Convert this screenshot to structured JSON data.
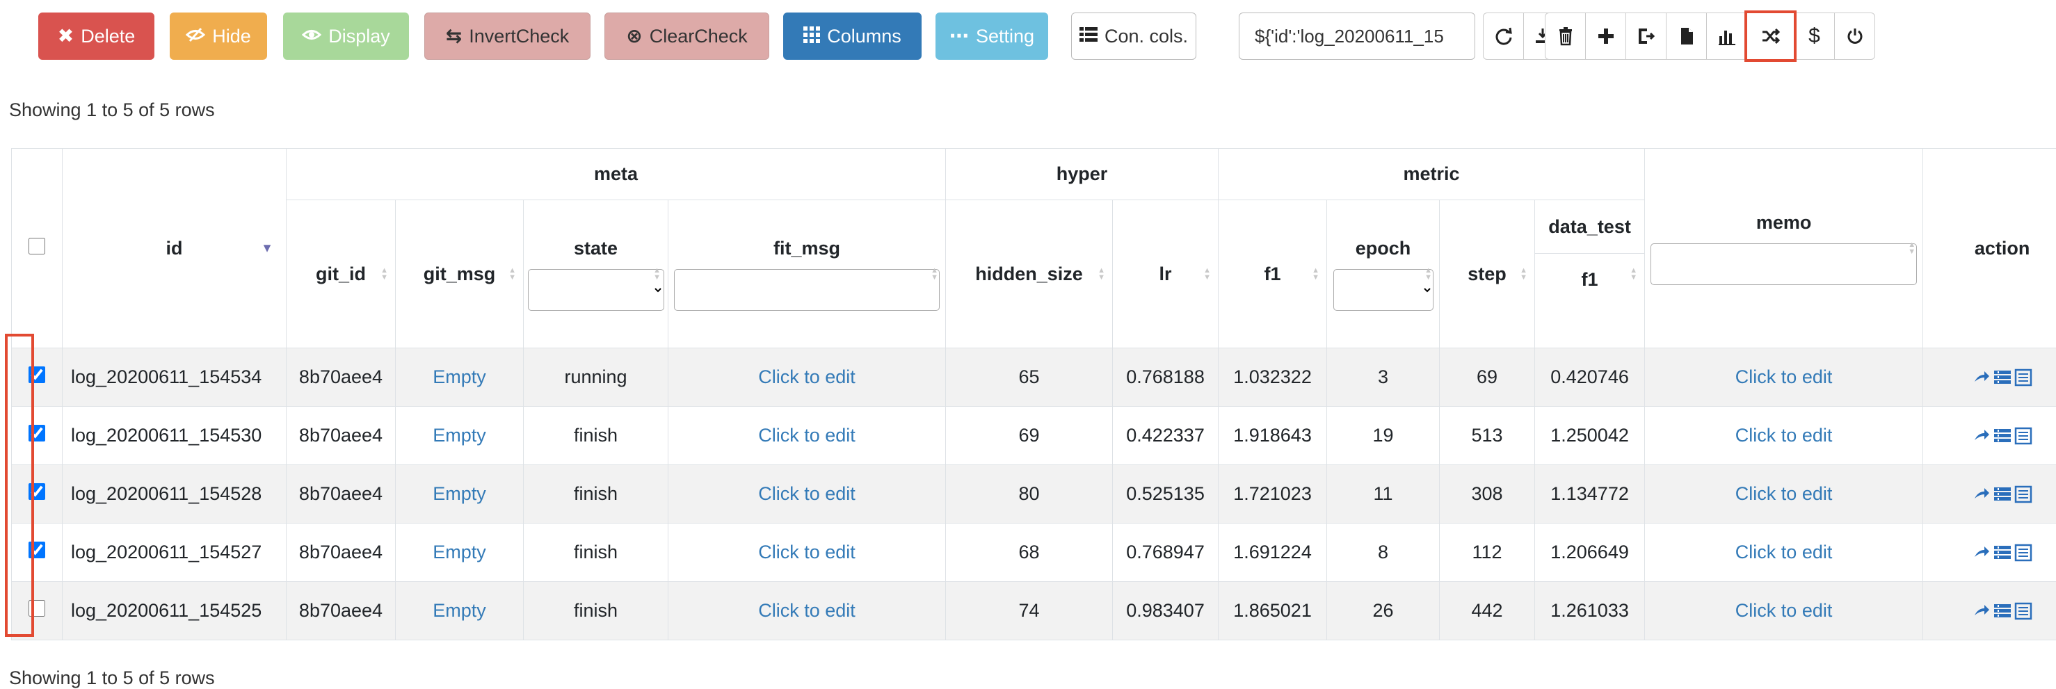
{
  "toolbar": {
    "delete_label": "Delete",
    "hide_label": "Hide",
    "display_label": "Display",
    "invert_label": "InvertCheck",
    "clear_label": "ClearCheck",
    "columns_label": "Columns",
    "setting_label": "Setting",
    "concols_label": "Con. cols.",
    "query_value": "${'id':'log_20200611_15",
    "icons": [
      "refresh-icon",
      "export-icon",
      "trash-icon",
      "plus-icon",
      "compare-icon",
      "file-icon",
      "chart-icon",
      "shuffle-icon",
      "dollar-icon",
      "power-icon"
    ],
    "highlighted_icon": "shuffle-icon",
    "colors": {
      "delete": "#d9534f",
      "hide": "#f0ad4e",
      "display": "#a8d89a",
      "check": "#ddaaa8",
      "columns": "#337ab7",
      "setting": "#6ec1e0",
      "highlight": "#e24a32",
      "link": "#337ab7"
    }
  },
  "pagination": {
    "top_text": "Showing 1 to 5 of 5 rows",
    "bottom_text": "Showing 1 to 5 of 5 rows"
  },
  "table": {
    "groups": {
      "meta": "meta",
      "hyper": "hyper",
      "metric": "metric"
    },
    "headers": {
      "id": "id",
      "git_id": "git_id",
      "git_msg": "git_msg",
      "state": "state",
      "fit_msg": "fit_msg",
      "hidden_size": "hidden_size",
      "lr": "lr",
      "f1": "f1",
      "epoch": "epoch",
      "step": "step",
      "data_test": "data_test",
      "data_test_f1": "f1",
      "memo": "memo",
      "action": "action"
    },
    "rows": [
      {
        "checked": true,
        "id": "log_20200611_154534",
        "git_id": "8b70aee4",
        "git_msg": "Empty",
        "state": "running",
        "fit_msg": "Click to edit",
        "hidden_size": "65",
        "lr": "0.768188",
        "f1": "1.032322",
        "epoch": "3",
        "step": "69",
        "test_f1": "0.420746",
        "memo": "Click to edit"
      },
      {
        "checked": true,
        "id": "log_20200611_154530",
        "git_id": "8b70aee4",
        "git_msg": "Empty",
        "state": "finish",
        "fit_msg": "Click to edit",
        "hidden_size": "69",
        "lr": "0.422337",
        "f1": "1.918643",
        "epoch": "19",
        "step": "513",
        "test_f1": "1.250042",
        "memo": "Click to edit"
      },
      {
        "checked": true,
        "id": "log_20200611_154528",
        "git_id": "8b70aee4",
        "git_msg": "Empty",
        "state": "finish",
        "fit_msg": "Click to edit",
        "hidden_size": "80",
        "lr": "0.525135",
        "f1": "1.721023",
        "epoch": "11",
        "step": "308",
        "test_f1": "1.134772",
        "memo": "Click to edit"
      },
      {
        "checked": true,
        "id": "log_20200611_154527",
        "git_id": "8b70aee4",
        "git_msg": "Empty",
        "state": "finish",
        "fit_msg": "Click to edit",
        "hidden_size": "68",
        "lr": "0.768947",
        "f1": "1.691224",
        "epoch": "8",
        "step": "112",
        "test_f1": "1.206649",
        "memo": "Click to edit"
      },
      {
        "checked": false,
        "id": "log_20200611_154525",
        "git_id": "8b70aee4",
        "git_msg": "Empty",
        "state": "finish",
        "fit_msg": "Click to edit",
        "hidden_size": "74",
        "lr": "0.983407",
        "f1": "1.865021",
        "epoch": "26",
        "step": "442",
        "test_f1": "1.261033",
        "memo": "Click to edit"
      }
    ],
    "action_icons": [
      "arrow-icon",
      "list-icon",
      "table-icon"
    ]
  }
}
